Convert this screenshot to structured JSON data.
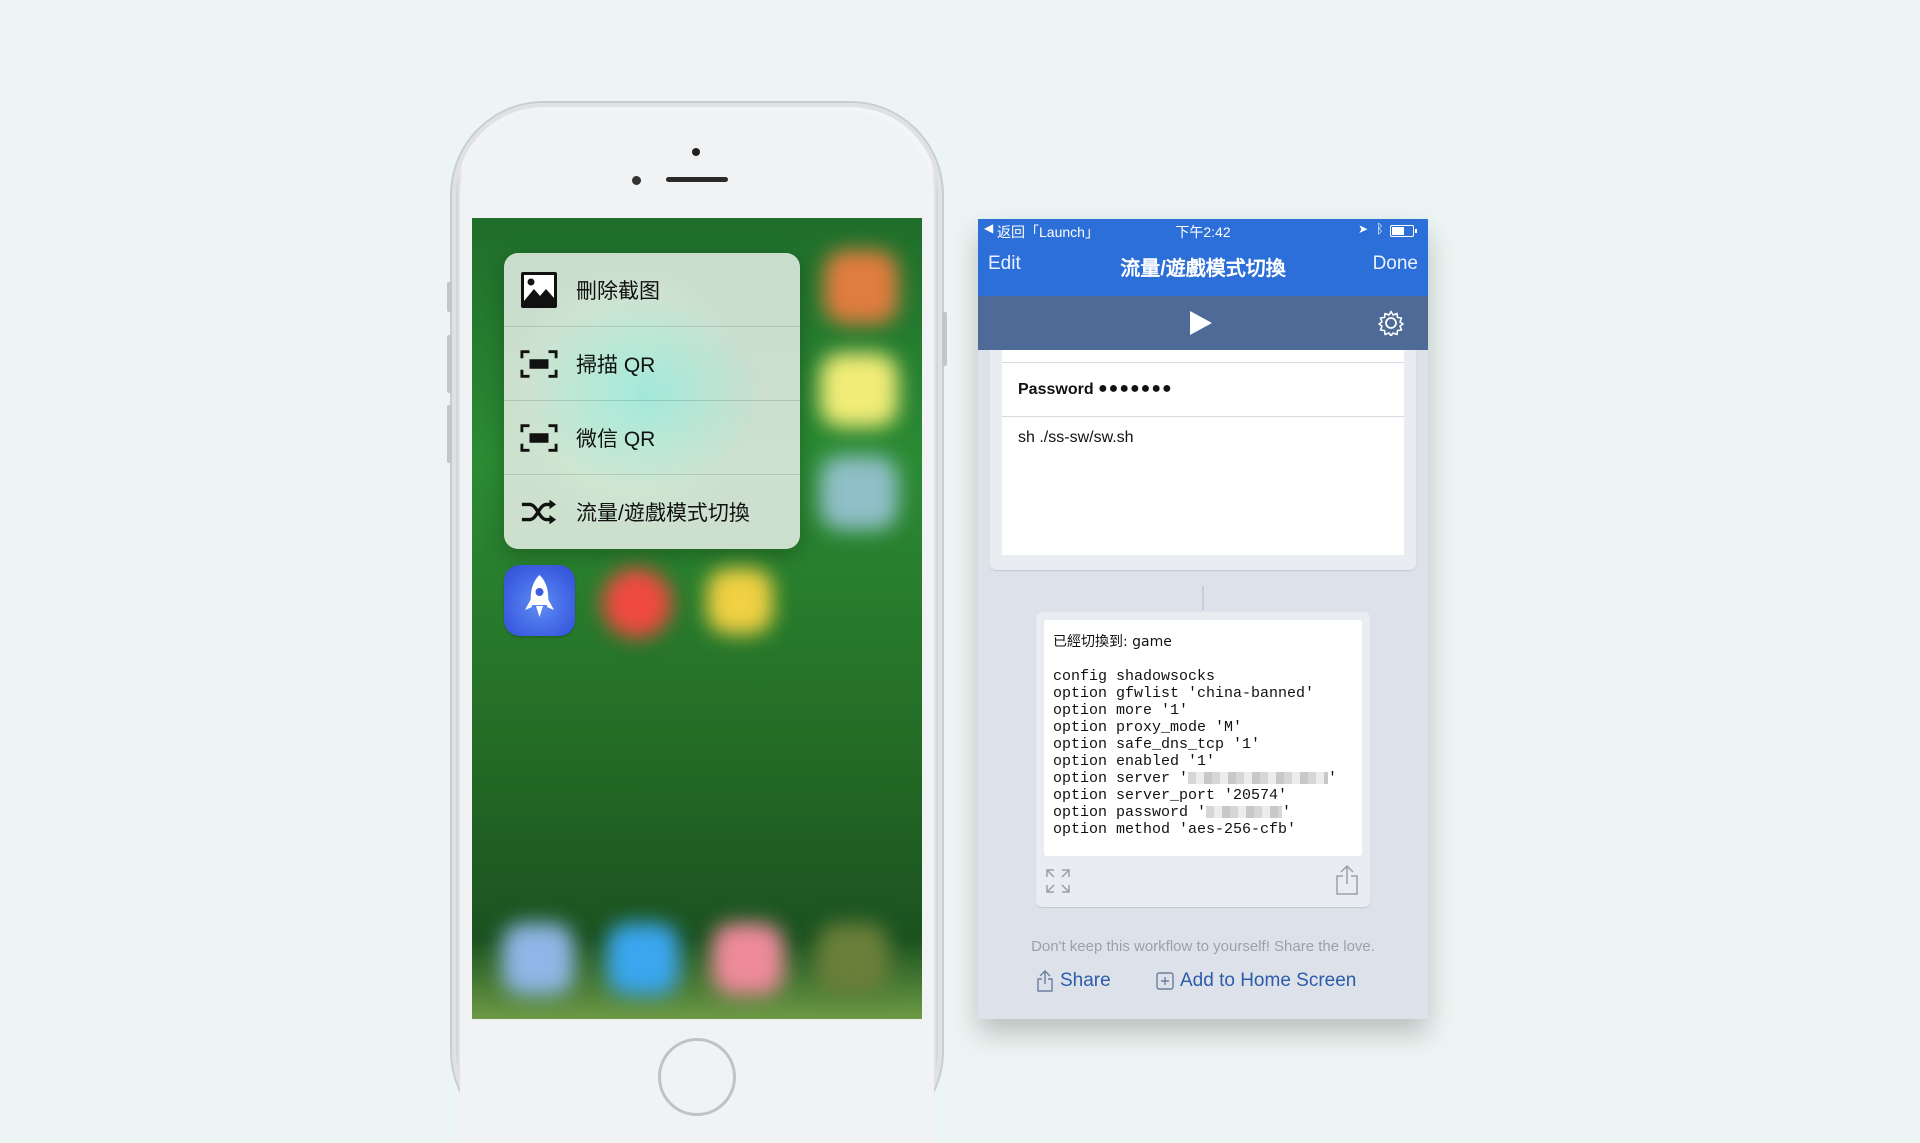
{
  "quick_actions": {
    "items": [
      {
        "label": "刪除截图",
        "icon": "photo-icon"
      },
      {
        "label": "掃描 QR",
        "icon": "qr-scan-icon"
      },
      {
        "label": "微信 QR",
        "icon": "qr-scan-icon"
      },
      {
        "label": "流量/遊戲模式切換",
        "icon": "shuffle-icon"
      }
    ]
  },
  "status_bar": {
    "back_label": "返回「Launch」",
    "time": "下午2:42"
  },
  "nav": {
    "edit_label": "Edit",
    "title": "流量/遊戲模式切換",
    "done_label": "Done"
  },
  "workflow": {
    "password_label": "Password",
    "password_value": "●●●●●●●",
    "script_text": "sh ./ss-sw/sw.sh",
    "output_lines": [
      "已經切換到: game",
      "",
      "config shadowsocks",
      "option gfwlist 'china-banned'",
      "option more '1'",
      "option proxy_mode 'M'",
      "option safe_dns_tcp '1'",
      "option enabled '1'",
      "option server '",
      "option server_port '20574'",
      "option password '",
      "option method 'aes-256-cfb'"
    ],
    "output_suffix": "'"
  },
  "footer": {
    "message": "Don't keep this workflow to yourself! Share the love.",
    "share_label": "Share",
    "add_home_label": "Add to Home Screen"
  },
  "colors": {
    "nav_blue": "#2d6fd8",
    "toolbar": "#4d6b96",
    "link_blue": "#2d5ba8"
  }
}
